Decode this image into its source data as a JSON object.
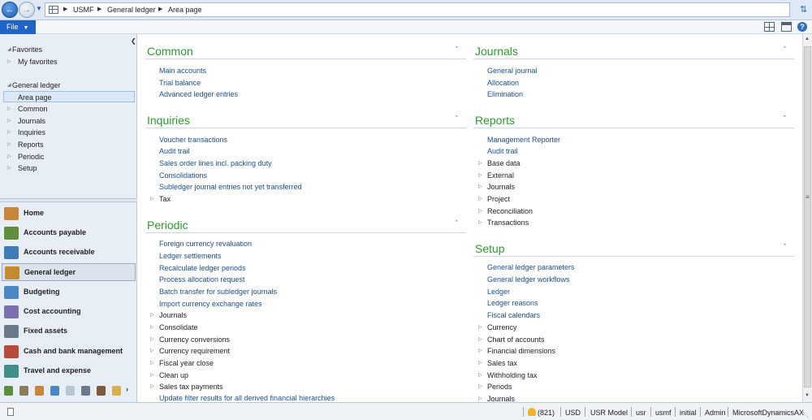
{
  "address": {
    "crumbs": [
      "USMF",
      "General ledger",
      "Area page"
    ]
  },
  "menu": {
    "file_label": "File"
  },
  "nav": {
    "favorites_header": "Favorites",
    "favorites": [
      "My favorites"
    ],
    "module_header": "General ledger",
    "selected_item": "Area page",
    "items": [
      "Common",
      "Journals",
      "Inquiries",
      "Reports",
      "Periodic",
      "Setup"
    ]
  },
  "modules": [
    {
      "label": "Home",
      "color": "#c9853a"
    },
    {
      "label": "Accounts payable",
      "color": "#5e8f3a"
    },
    {
      "label": "Accounts receivable",
      "color": "#3e7cb8"
    },
    {
      "label": "General ledger",
      "color": "#c58a2c",
      "active": true
    },
    {
      "label": "Budgeting",
      "color": "#4a87c5"
    },
    {
      "label": "Cost accounting",
      "color": "#7a6fb0"
    },
    {
      "label": "Fixed assets",
      "color": "#6b7a8a"
    },
    {
      "label": "Cash and bank management",
      "color": "#b84a3a"
    },
    {
      "label": "Travel and expense",
      "color": "#3f8f8a"
    }
  ],
  "groups": {
    "common": {
      "title": "Common",
      "links": [
        "Main accounts",
        "Trial balance",
        "Advanced ledger entries"
      ]
    },
    "inquiries": {
      "title": "Inquiries",
      "links": [
        "Voucher transactions",
        "Audit trail",
        "Sales order lines incl. packing duty",
        "Consolidations",
        "Subledger journal entries not yet transferred"
      ],
      "folders": [
        "Tax"
      ]
    },
    "periodic": {
      "title": "Periodic",
      "links": [
        "Foreign currency revaluation",
        "Ledger settlements",
        "Recalculate ledger periods",
        "Process allocation request",
        "Batch transfer for subledger journals",
        "Import currency exchange rates"
      ],
      "folders": [
        "Journals",
        "Consolidate",
        "Currency conversions",
        "Currency requirement",
        "Fiscal year close",
        "Clean up",
        "Sales tax payments"
      ],
      "trailing_link": "Update filter results for all derived financial hierarchies"
    },
    "journals": {
      "title": "Journals",
      "links": [
        "General journal",
        "Allocation",
        "Elimination"
      ]
    },
    "reports": {
      "title": "Reports",
      "links": [
        "Management Reporter",
        "Audit trail"
      ],
      "folders": [
        "Base data",
        "External",
        "Journals",
        "Project",
        "Reconciliation",
        "Transactions"
      ]
    },
    "setup": {
      "title": "Setup",
      "links": [
        "General ledger parameters",
        "General ledger workflows",
        "Ledger",
        "Ledger reasons",
        "Fiscal calendars"
      ],
      "folders": [
        "Currency",
        "Chart of accounts",
        "Financial dimensions",
        "Sales tax",
        "Withholding tax",
        "Periods",
        "Journals"
      ]
    }
  },
  "status": {
    "alerts": "(821)",
    "currency": "USD",
    "model": "USR Model",
    "layer": "usr",
    "company": "usmf",
    "partition": "initial",
    "user": "Admin",
    "server": "MicrosoftDynamicsAX"
  }
}
